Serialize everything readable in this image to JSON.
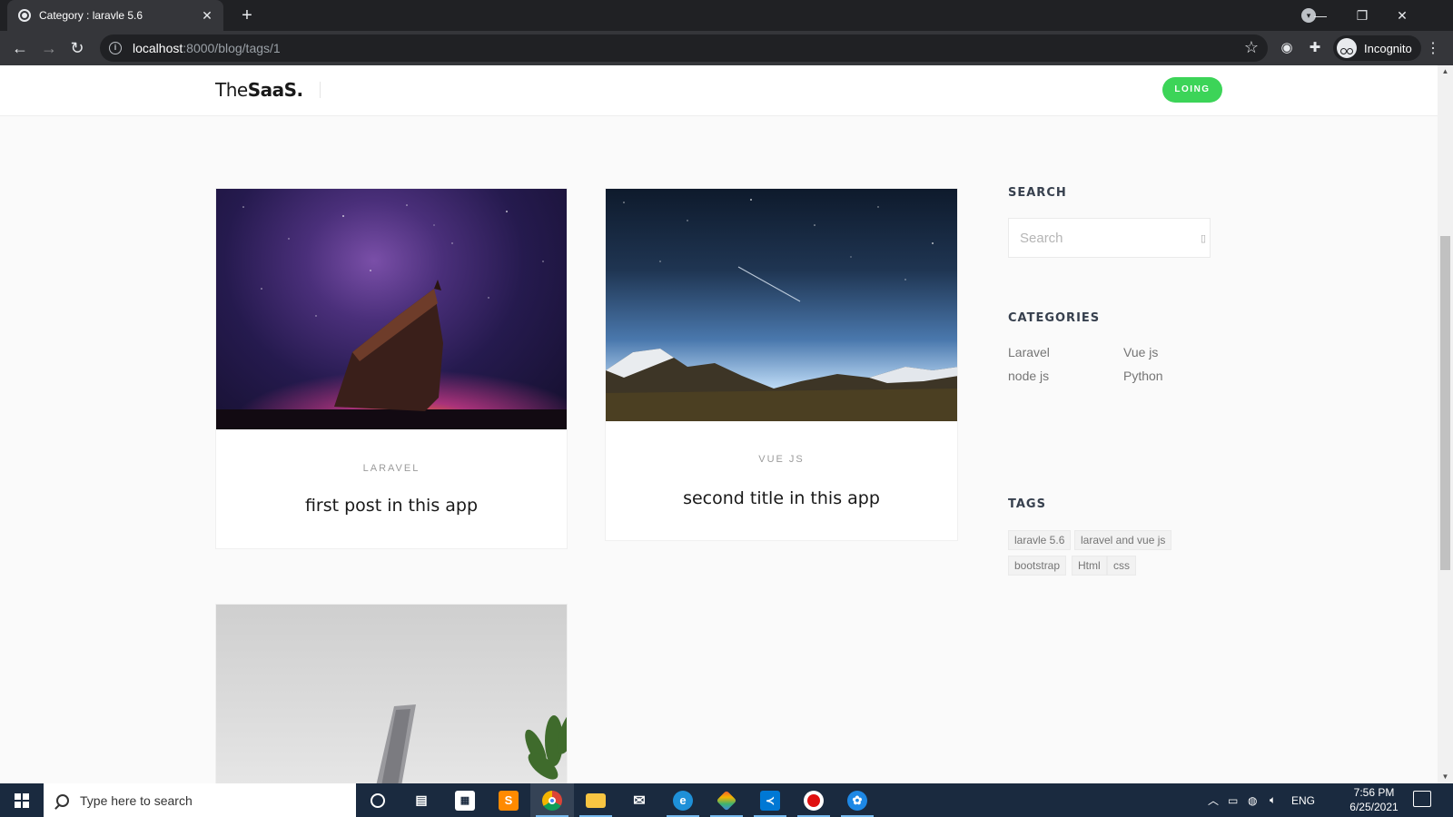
{
  "browser": {
    "tab_title": "Category : laravle 5.6",
    "new_tab": "+",
    "url_host": "localhost",
    "url_rest": ":8000/blog/tags/1",
    "profile_label": "Incognito"
  },
  "site": {
    "logo_light": "The",
    "logo_bold": "SaaS.",
    "login_label": "LOING"
  },
  "posts": [
    {
      "category": "LARAVEL",
      "title": "first post in this app"
    },
    {
      "category": "VUE JS",
      "title": "second title in this app"
    },
    {
      "category": "",
      "title": ""
    }
  ],
  "sidebar": {
    "search_heading": "SEARCH",
    "search_placeholder": "Search",
    "categories_heading": "CATEGORIES",
    "categories": [
      "Laravel",
      "Vue js",
      "node js",
      "Python"
    ],
    "tags_heading": "TAGS",
    "tags": [
      "laravle 5.6",
      "laravel and vue js",
      "bootstrap",
      "Html",
      "css"
    ]
  },
  "taskbar": {
    "search_placeholder": "Type here to search",
    "language": "ENG",
    "time": "7:56 PM",
    "date": "6/25/2021",
    "apps": [
      "cortana-icon",
      "task-view-icon",
      "store-icon",
      "sublime-text-icon",
      "chrome-icon",
      "file-explorer-icon",
      "mail-icon",
      "edge-icon",
      "git-icon",
      "vscode-icon",
      "recorder-icon",
      "app-icon"
    ]
  },
  "colors": {
    "accent_green": "#3cd458",
    "browser_dark": "#202124",
    "taskbar": "#1a2a3f"
  }
}
